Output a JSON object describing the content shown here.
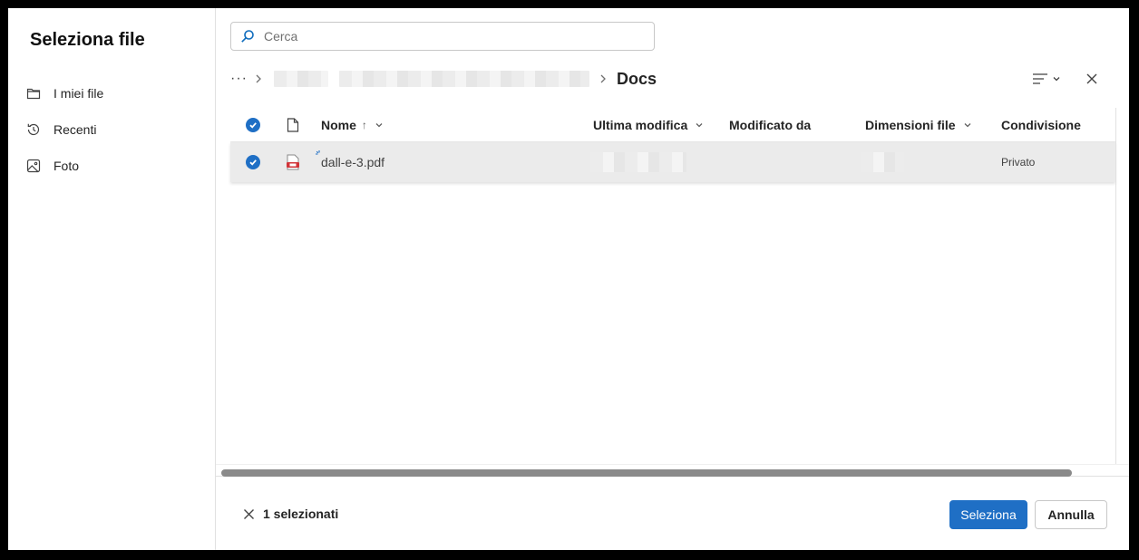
{
  "dialog": {
    "title": "Seleziona file"
  },
  "sidebar": {
    "items": [
      {
        "label": "I miei file",
        "icon": "folder-icon"
      },
      {
        "label": "Recenti",
        "icon": "history-icon"
      },
      {
        "label": "Foto",
        "icon": "image-icon"
      }
    ]
  },
  "search": {
    "placeholder": "Cerca",
    "value": ""
  },
  "breadcrumb": {
    "more": "···",
    "current": "Docs"
  },
  "table": {
    "columns": {
      "name": "Nome",
      "name_sort": "↑",
      "modified": "Ultima modifica",
      "modified_by": "Modificato da",
      "size": "Dimensioni file",
      "sharing": "Condivisione"
    },
    "rows": [
      {
        "name": "dall-e-3.pdf",
        "sharing": "Privato",
        "selected": true,
        "icon": "pdf-icon"
      }
    ]
  },
  "footer": {
    "selected_count": "1 selezionati",
    "select_button": "Seleziona",
    "cancel_button": "Annulla"
  },
  "colors": {
    "accent": "#1f6fc5",
    "selected_row": "#ebebeb",
    "pdf": "#d13438"
  }
}
